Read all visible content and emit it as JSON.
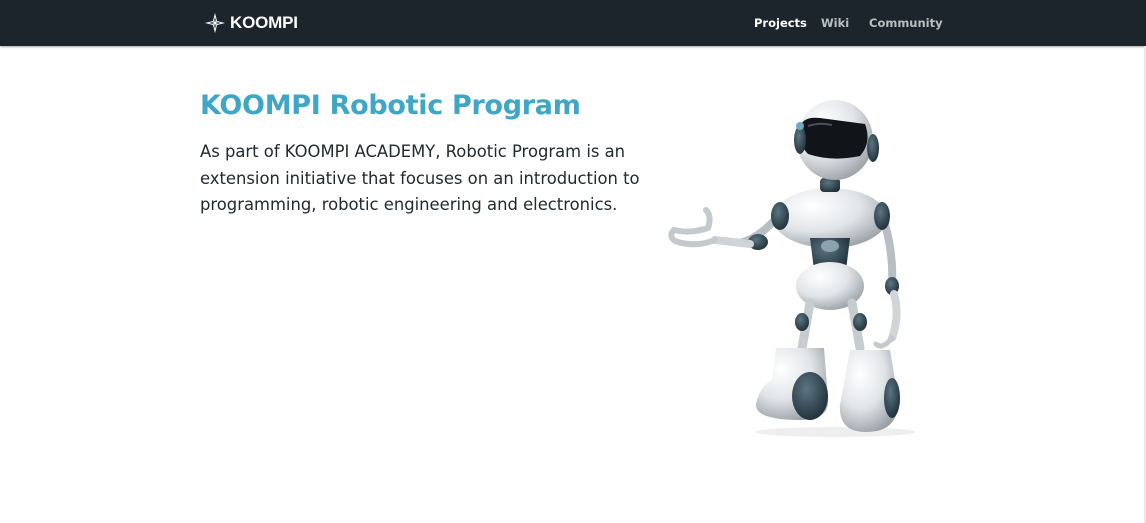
{
  "brand": {
    "name": "KOOMPI",
    "icon": "koompi-star-logo"
  },
  "nav": {
    "items": [
      {
        "label": "Projects",
        "active": true
      },
      {
        "label": "Wiki",
        "active": false
      },
      {
        "label": "Community",
        "active": false
      }
    ]
  },
  "hero": {
    "title": "KOOMPI Robotic Program",
    "description": "As part of KOOMPI ACADEMY, Robotic Program is an extension initiative that focuses on an introduction to programming, robotic engineering and electronics.",
    "image": "robot-illustration"
  },
  "colors": {
    "navbar_bg": "#1c252b",
    "title": "#3fa6c6",
    "body_text": "#222a30",
    "nav_active": "#ffffff",
    "nav_inactive": "#b9c0c4"
  }
}
